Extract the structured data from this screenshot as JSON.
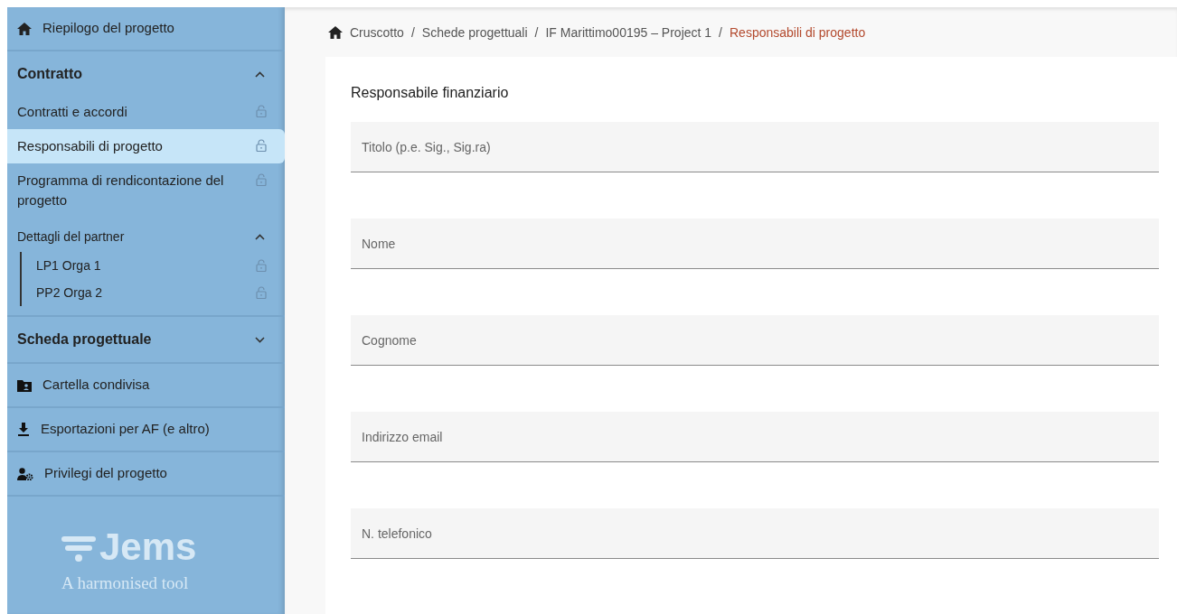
{
  "sidebar": {
    "items": [
      {
        "kind": "home",
        "label": "Riepilogo del progetto"
      },
      {
        "kind": "section",
        "label": "Contratto",
        "expanded": true,
        "children": [
          {
            "kind": "item",
            "label": "Contratti e accordi",
            "locked": true,
            "selected": false
          },
          {
            "kind": "item",
            "label": "Responsabili di progetto",
            "locked": true,
            "selected": true
          },
          {
            "kind": "item",
            "label": "Programma di rendicontazione del progetto",
            "locked": true,
            "selected": false
          },
          {
            "kind": "group",
            "label": "Dettagli del partner",
            "expanded": true,
            "children": [
              {
                "label": "LP1 Orga 1",
                "locked": true,
                "selected": false
              },
              {
                "label": "PP2 Orga 2",
                "locked": true,
                "selected": false
              }
            ]
          }
        ]
      },
      {
        "kind": "section",
        "label": "Scheda progettuale",
        "expanded": false
      },
      {
        "kind": "folder",
        "label": "Cartella condivisa"
      },
      {
        "kind": "download",
        "label": "Esportazioni per AF (e altro)"
      },
      {
        "kind": "privileges",
        "label": "Privilegi del progetto"
      }
    ],
    "logo": {
      "name": "Jems",
      "tagline": "A harmonised tool"
    }
  },
  "breadcrumb": [
    {
      "label": "Cruscotto",
      "current": false
    },
    {
      "label": "Schede progettuali",
      "current": false
    },
    {
      "label": "IF Marittimo00195 – Project 1",
      "current": false
    },
    {
      "label": "Responsabili di progetto",
      "current": true
    }
  ],
  "breadcrumb_separator": "/",
  "form": {
    "title": "Responsabile finanziario",
    "fields": [
      {
        "placeholder": "Titolo (p.e. Sig., Sig.ra)"
      },
      {
        "placeholder": "Nome"
      },
      {
        "placeholder": "Cognome"
      },
      {
        "placeholder": "Indirizzo email"
      },
      {
        "placeholder": "N. telefonico"
      }
    ]
  }
}
